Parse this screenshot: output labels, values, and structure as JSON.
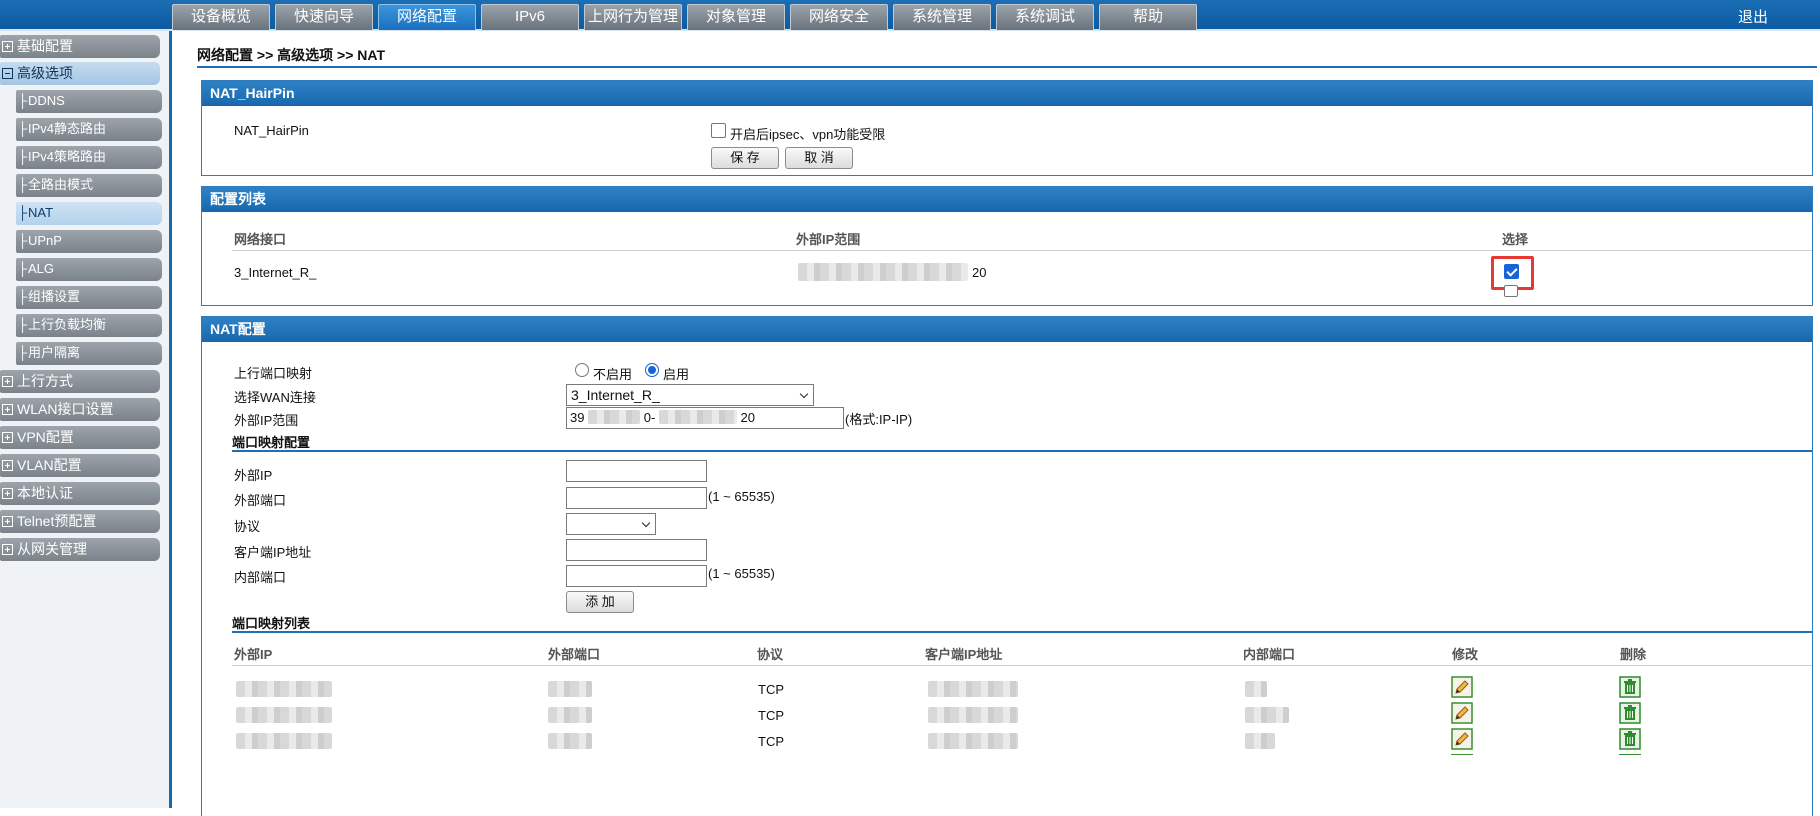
{
  "nav": {
    "tabs": [
      "设备概览",
      "快速向导",
      "网络配置",
      "IPv6",
      "上网行为管理",
      "对象管理",
      "网络安全",
      "系统管理",
      "系统调试",
      "帮助"
    ],
    "active_tab": "网络配置",
    "logout": "退出"
  },
  "sidebar": {
    "groups_top": [
      {
        "label": "基础配置",
        "expanded": false
      },
      {
        "label": "高级选项",
        "expanded": true
      }
    ],
    "sub_items": [
      "DDNS",
      "IPv4静态路由",
      "IPv4策略路由",
      "全路由模式",
      "NAT",
      "UPnP",
      "ALG",
      "组播设置",
      "上行负载均衡",
      "用户隔离"
    ],
    "active_sub": "NAT",
    "groups_bottom": [
      "上行方式",
      "WLAN接口设置",
      "VPN配置",
      "VLAN配置",
      "本地认证",
      "Telnet预配置",
      "从网关管理"
    ]
  },
  "breadcrumb": "网络配置 >> 高级选项 >> NAT",
  "hairpin": {
    "title": "NAT_HairPin",
    "label": "NAT_HairPin",
    "checkbox_label": "开启后ipsec、vpn功能受限",
    "checked": false,
    "save": "保 存",
    "cancel": "取 消"
  },
  "config_list": {
    "title": "配置列表",
    "col_iface": "网络接口",
    "col_ip_range": "外部IP范围",
    "col_select": "选择",
    "row": {
      "iface": "3_Internet_R_",
      "ip_range_visible": "20",
      "selected": true
    }
  },
  "nat": {
    "title": "NAT配置",
    "uplink_map_label": "上行端口映射",
    "opt_disable": "不启用",
    "opt_enable": "启用",
    "enabled": true,
    "wan_label": "选择WAN连接",
    "wan_value": "3_Internet_R_",
    "ext_ip_range_label": "外部IP范围",
    "ext_ip_range_value_a": "39",
    "ext_ip_range_value_b": "0-",
    "ext_ip_range_value_c": "20",
    "ext_ip_range_hint": "(格式:IP-IP)",
    "port_map_cfg_title": "端口映射配置",
    "ext_ip_label": "外部IP",
    "ext_port_label": "外部端口",
    "port_range_hint": "(1 ~ 65535)",
    "protocol_label": "协议",
    "client_ip_label": "客户端IP地址",
    "int_port_label": "内部端口",
    "add_button": "添 加",
    "port_map_list_title": "端口映射列表",
    "table": {
      "headers": [
        "外部IP",
        "外部端口",
        "协议",
        "客户端IP地址",
        "内部端口",
        "修改",
        "删除"
      ],
      "rows": [
        {
          "protocol": "TCP"
        },
        {
          "protocol": "TCP"
        },
        {
          "protocol": "TCP"
        }
      ]
    }
  },
  "colors": {
    "brand_blue": "#1867ae",
    "highlight_red": "#e53935",
    "edit_icon": "#3f8f2e",
    "delete_icon": "#2e8b2e"
  },
  "icons": {
    "edit": "pencil-edit-icon",
    "delete": "trash-icon"
  }
}
